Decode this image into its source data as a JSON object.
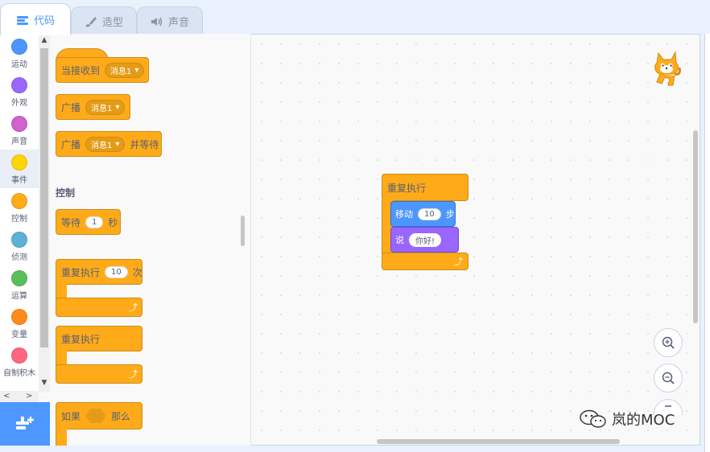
{
  "tabs": [
    {
      "label": "代码",
      "icon": "code-icon",
      "active": true
    },
    {
      "label": "造型",
      "icon": "brush-icon",
      "active": false
    },
    {
      "label": "声音",
      "icon": "speaker-icon",
      "active": false
    }
  ],
  "categories": [
    {
      "label": "运动",
      "color": "#4c97ff"
    },
    {
      "label": "外观",
      "color": "#9966ff"
    },
    {
      "label": "声音",
      "color": "#cf63cf"
    },
    {
      "label": "事件",
      "color": "#ffd500",
      "selected": true
    },
    {
      "label": "控制",
      "color": "#ffab19"
    },
    {
      "label": "侦测",
      "color": "#5cb1d6"
    },
    {
      "label": "运算",
      "color": "#59c059"
    },
    {
      "label": "变量",
      "color": "#ff8c1a"
    },
    {
      "label": "自制积木",
      "color": "#ff6680"
    }
  ],
  "palette": {
    "events": {
      "when_receive": {
        "text": "当接收到",
        "value": "消息1"
      },
      "broadcast": {
        "text": "广播",
        "value": "消息1"
      },
      "broadcast_wait": {
        "text": "广播",
        "value": "消息1",
        "suffix": "并等待"
      }
    },
    "control_title": "控制",
    "control": {
      "wait": {
        "text": "等待",
        "value": "1",
        "suffix": "秒"
      },
      "repeat": {
        "text": "重复执行",
        "value": "10",
        "suffix": "次"
      },
      "forever": {
        "text": "重复执行"
      },
      "if_then": {
        "text": "如果",
        "suffix": "那么"
      }
    }
  },
  "script": {
    "forever": "重复执行",
    "move": {
      "text": "移动",
      "value": "10",
      "suffix": "步"
    },
    "say": {
      "text": "说",
      "value": "你好!"
    }
  },
  "watermark": "岚的MOC",
  "colors": {
    "control": "#ffab19",
    "motion": "#4c97ff",
    "looks": "#9966ff",
    "accent": "#4d97ff"
  }
}
